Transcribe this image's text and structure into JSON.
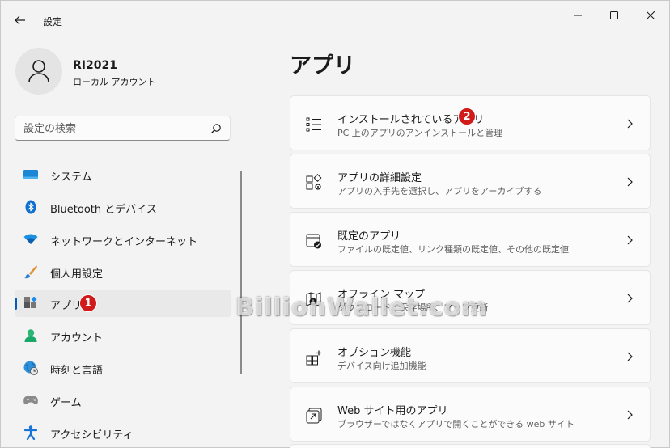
{
  "window": {
    "title": "設定"
  },
  "profile": {
    "name": "RI2021",
    "account_type": "ローカル アカウント"
  },
  "search": {
    "placeholder": "設定の検索"
  },
  "nav": {
    "items": [
      {
        "label": "システム",
        "icon": "system-icon"
      },
      {
        "label": "Bluetooth とデバイス",
        "icon": "bluetooth-icon"
      },
      {
        "label": "ネットワークとインターネット",
        "icon": "network-icon"
      },
      {
        "label": "個人用設定",
        "icon": "personalization-icon"
      },
      {
        "label": "アプリ",
        "icon": "apps-icon",
        "selected": true,
        "badge": "1"
      },
      {
        "label": "アカウント",
        "icon": "accounts-icon"
      },
      {
        "label": "時刻と言語",
        "icon": "time-language-icon"
      },
      {
        "label": "ゲーム",
        "icon": "gaming-icon"
      },
      {
        "label": "アクセシビリティ",
        "icon": "accessibility-icon"
      }
    ]
  },
  "main": {
    "title": "アプリ",
    "cards": [
      {
        "title": "インストールされているアプリ",
        "desc": "PC 上のアプリのアンインストールと管理",
        "icon": "installed-apps-icon",
        "badge": "2"
      },
      {
        "title": "アプリの詳細設定",
        "desc": "アプリの入手先を選択し、アプリをアーカイブする",
        "icon": "advanced-app-settings-icon"
      },
      {
        "title": "既定のアプリ",
        "desc": "ファイルの既定値、リンク種類の既定値、その他の既定値",
        "icon": "default-apps-icon"
      },
      {
        "title": "オフライン マップ",
        "desc": "ダウンロード、保存場所、マップ更新",
        "icon": "offline-maps-icon"
      },
      {
        "title": "オプション機能",
        "desc": "デバイス向け追加機能",
        "icon": "optional-features-icon"
      },
      {
        "title": "Web サイト用のアプリ",
        "desc": "ブラウザーではなくアプリで開くことができる web サイト",
        "icon": "apps-for-websites-icon"
      }
    ]
  },
  "watermark": "BillionWallet.com",
  "colors": {
    "accent": "#005fb8",
    "badge": "#d11a1a",
    "background": "#f3f3f3",
    "card": "#fbfbfb"
  }
}
